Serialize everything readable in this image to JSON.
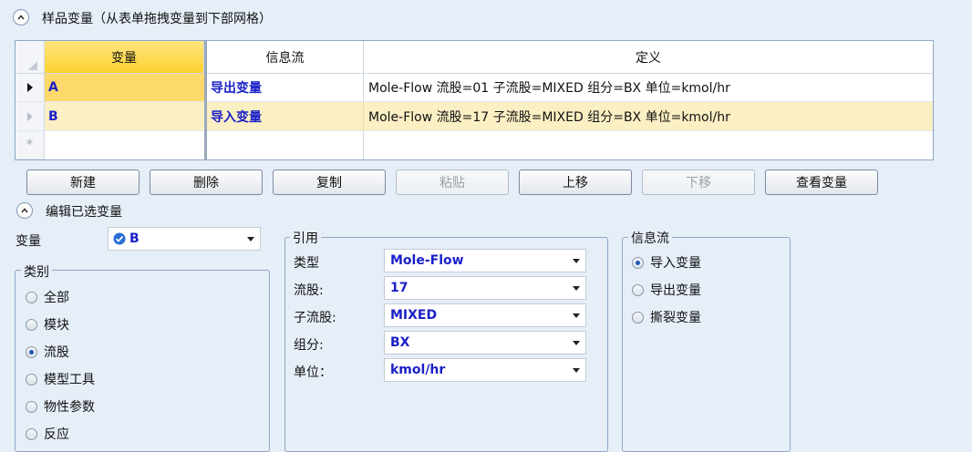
{
  "sample_section": {
    "title": "样品变量（从表单拖拽变量到下部网格）"
  },
  "grid": {
    "columns": [
      "变量",
      "信息流",
      "定义"
    ],
    "rows": [
      {
        "variable": "A",
        "flow": "导出变量",
        "definition": "Mole-Flow 流股=01 子流股=MIXED 组分=BX 单位=kmol/hr"
      },
      {
        "variable": "B",
        "flow": "导入变量",
        "definition": "Mole-Flow 流股=17 子流股=MIXED 组分=BX 单位=kmol/hr"
      }
    ],
    "new_row_marker": "*"
  },
  "buttons": {
    "new": "新建",
    "delete": "删除",
    "copy": "复制",
    "paste": "粘贴",
    "move_up": "上移",
    "move_down": "下移",
    "view_variable": "查看变量"
  },
  "edit_section": {
    "title": "编辑已选变量",
    "variable_label": "变量",
    "variable_value": "B"
  },
  "category": {
    "title": "类别",
    "options": [
      "全部",
      "模块",
      "流股",
      "模型工具",
      "物性参数",
      "反应"
    ],
    "selected": "流股"
  },
  "reference": {
    "title": "引用",
    "type_label": "类型",
    "type_value": "Mole-Flow",
    "stream_label": "流股:",
    "stream_value": "17",
    "substream_label": "子流股:",
    "substream_value": "MIXED",
    "component_label": "组分:",
    "component_value": "BX",
    "unit_label": "单位：",
    "unit_value": "kmol/hr"
  },
  "info_flow": {
    "title": "信息流",
    "options": [
      "导入变量",
      "导出变量",
      "撕裂变量"
    ],
    "selected": "导入变量"
  },
  "colors": {
    "selection": "#fdd12f",
    "value_text": "#1a1fc8",
    "border": "#8ea6c6"
  }
}
